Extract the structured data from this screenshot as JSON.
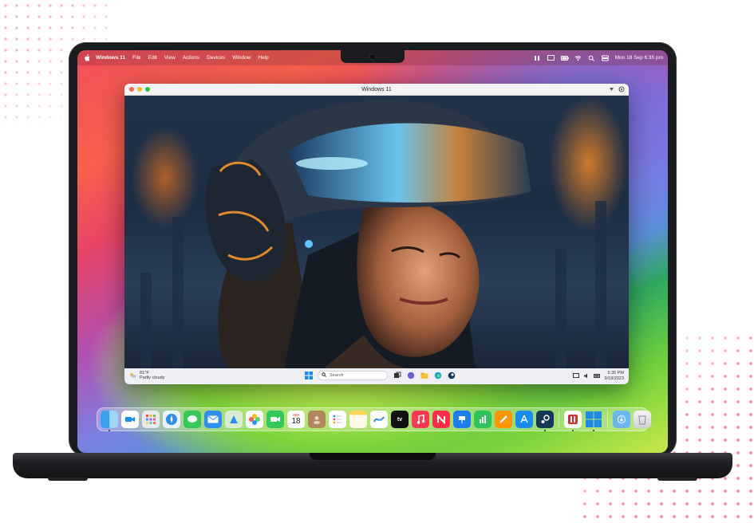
{
  "menubar": {
    "app_name": "Windows 11",
    "items": [
      "File",
      "Edit",
      "View",
      "Actions",
      "Devices",
      "Window",
      "Help"
    ],
    "datetime": "Mon 18 Sep  6:35 pm"
  },
  "vm_window": {
    "title": "Windows 11"
  },
  "taskbar": {
    "weather_temp": "81°F",
    "weather_desc": "Partly cloudy",
    "search_placeholder": "Search",
    "time": "6:35 PM",
    "date": "9/18/2023"
  },
  "dock": {
    "calendar_month": "SEP",
    "calendar_day": "18",
    "icons": [
      "finder-icon",
      "facetime-icon",
      "launchpad-icon",
      "safari-icon",
      "messages-icon",
      "mail-icon",
      "maps-icon",
      "photos-icon",
      "facetime-video-icon",
      "calendar-icon",
      "contacts-icon",
      "reminders-icon",
      "notes-icon",
      "freeform-icon",
      "apple-tv-icon",
      "music-icon",
      "news-icon",
      "keynote-icon",
      "numbers-icon",
      "pages-icon",
      "app-store-icon",
      "steam-icon",
      "parallels-icon",
      "windows-icon",
      "downloads-folder-icon",
      "trash-icon"
    ]
  },
  "colors": {
    "accent": "#f0505a",
    "dot_pattern": "#f08a95"
  }
}
